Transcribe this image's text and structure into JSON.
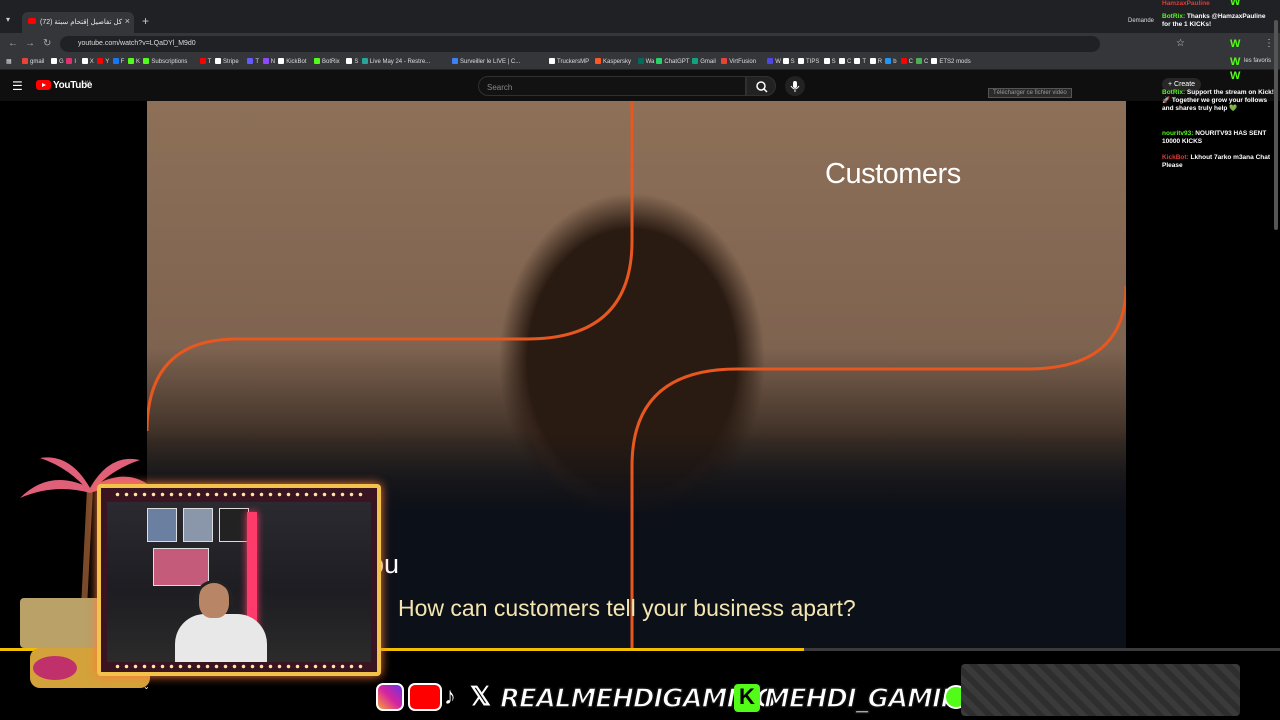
{
  "browser": {
    "tab_title": "(72) كل تفاصيل إقتحام سبتة",
    "new_tab": "+",
    "url": "youtube.com/watch?v=LQaDYl_M9d0",
    "bookmarks": [
      "gmail",
      "G",
      "I",
      "X",
      "Y",
      "F",
      "K",
      "Subscriptions",
      "T",
      "Stripe",
      "T",
      "N",
      "KickBot",
      "BotRix",
      "S",
      "Live May 24 - Restre...",
      "Surveiller le LIVE | C...",
      "TruckersMP",
      "Kaspersky",
      "Wa",
      "ChatGPT",
      "Gmail",
      "VirtFusion",
      "W",
      "S",
      "TIPS",
      "S",
      "C",
      "T",
      "R",
      "b",
      "C",
      "C",
      "ETS2 mods"
    ],
    "all_bookmarks": "les favoris",
    "extension_popup": "Demande"
  },
  "youtube": {
    "logo_text": "YouTube",
    "country": "MA",
    "search_placeholder": "Search",
    "create_label": "+ Create",
    "download_tip": "Télécharger ce fichier vidéo"
  },
  "video": {
    "headline": "Customers",
    "partial_text": "ou",
    "subtitle": "How can customers tell your business apart?",
    "progress_fraction": 0.628
  },
  "chat": {
    "messages": [
      {
        "user": "HamzaxPauline",
        "text": "",
        "user_color": "red"
      },
      {
        "user": "BotRix:",
        "text": "Thanks @HamzaxPauline for the 1 KICKs!",
        "user_color": "green"
      },
      {
        "user": "BotRix:",
        "text": "Support the stream on Kick! 🚀 Together we grow your follows and shares truly help 💚",
        "user_color": "green"
      },
      {
        "user": "nouritv93:",
        "text": "NOURITV93 HAS SENT 10000 KICKS",
        "user_color": "green"
      },
      {
        "user": "KickBot:",
        "text": "Lkhout 7arko m3ana Chat Please",
        "user_color": "red"
      }
    ],
    "w_marks": [
      "W",
      "W",
      "W",
      "W",
      "W"
    ]
  },
  "overlay": {
    "social_handle_1": "REALMEHDIGAMING",
    "social_handle_2": "MEHDI_GAMING",
    "kick_letter": "K"
  },
  "colors": {
    "progress": "#f0c000",
    "accent_orange": "#e8571f",
    "kick_green": "#53fc18",
    "youtube_red": "#ff0000"
  }
}
